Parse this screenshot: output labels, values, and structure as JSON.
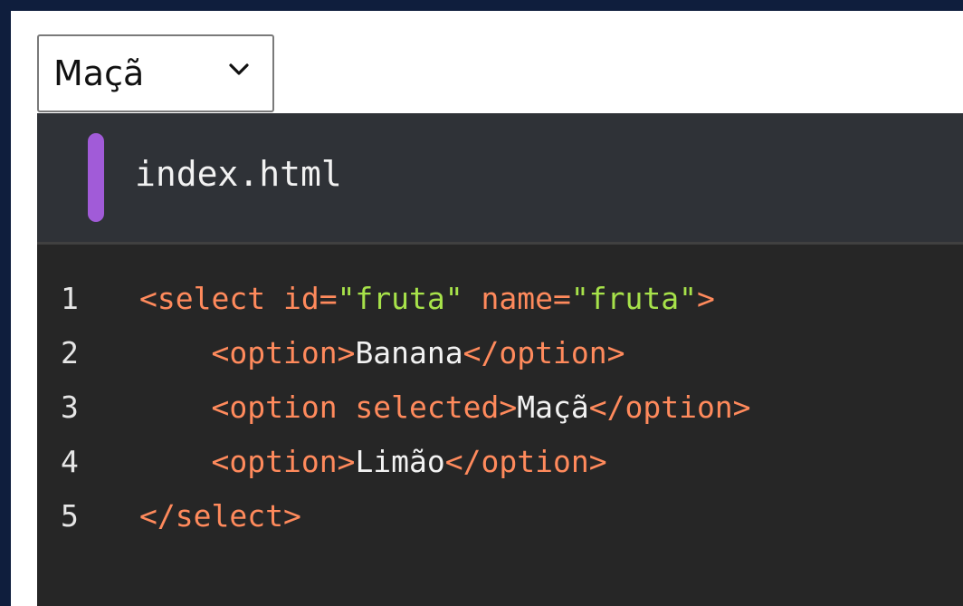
{
  "select": {
    "value": "Maçã"
  },
  "editor": {
    "filename": "index.html",
    "colors": {
      "tag": "#ff8a5c",
      "string": "#a7e24a",
      "text": "#f2f2f2",
      "accent": "#a15bd8"
    },
    "lines": [
      {
        "number": "1",
        "indent": "",
        "tokens": [
          {
            "type": "tag",
            "text": "<select "
          },
          {
            "type": "attr",
            "text": "id="
          },
          {
            "type": "str",
            "text": "\"fruta\""
          },
          {
            "type": "attr",
            "text": " name="
          },
          {
            "type": "str",
            "text": "\"fruta\""
          },
          {
            "type": "tag",
            "text": ">"
          }
        ]
      },
      {
        "number": "2",
        "indent": "    ",
        "tokens": [
          {
            "type": "tag",
            "text": "<option>"
          },
          {
            "type": "txt",
            "text": "Banana"
          },
          {
            "type": "tag",
            "text": "</option>"
          }
        ]
      },
      {
        "number": "3",
        "indent": "    ",
        "tokens": [
          {
            "type": "tag",
            "text": "<option selected>"
          },
          {
            "type": "txt",
            "text": "Maçã"
          },
          {
            "type": "tag",
            "text": "</option>"
          }
        ]
      },
      {
        "number": "4",
        "indent": "    ",
        "tokens": [
          {
            "type": "tag",
            "text": "<option>"
          },
          {
            "type": "txt",
            "text": "Limão"
          },
          {
            "type": "tag",
            "text": "</option>"
          }
        ]
      },
      {
        "number": "5",
        "indent": "",
        "tokens": [
          {
            "type": "tag",
            "text": "</select>"
          }
        ]
      }
    ]
  }
}
